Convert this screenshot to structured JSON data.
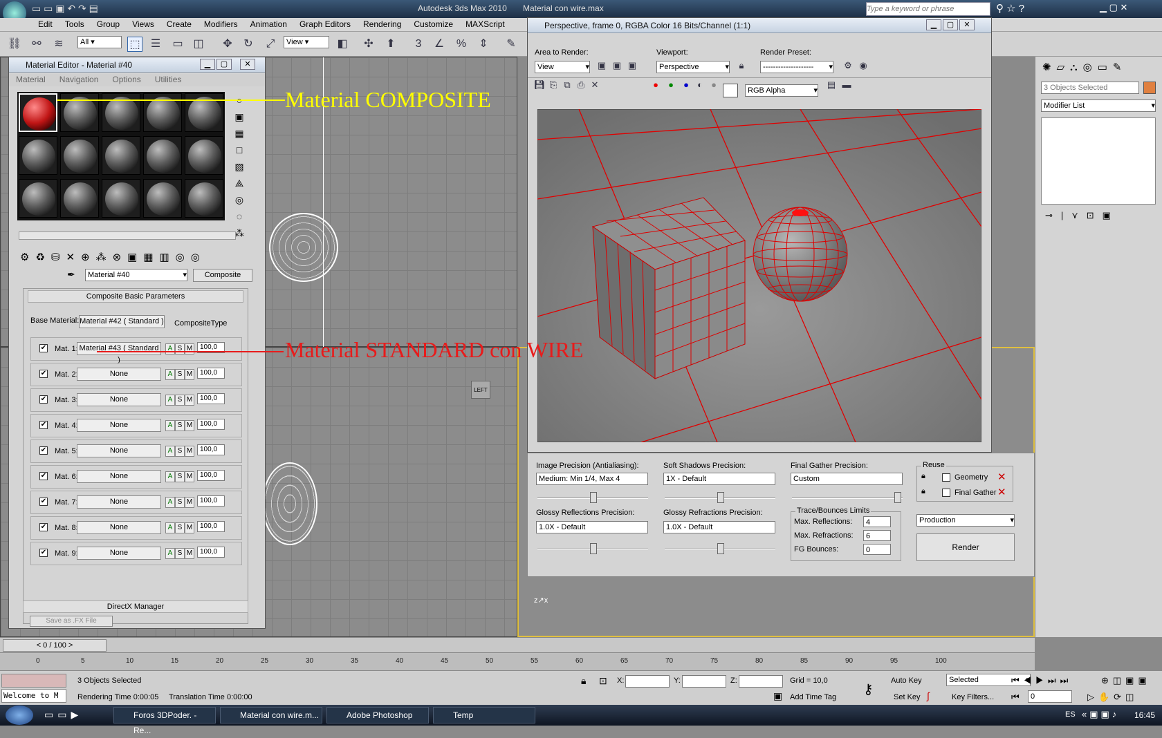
{
  "app": {
    "title": "Autodesk 3ds Max  2010",
    "file": "Material con wire.max",
    "search_placeholder": "Type a keyword or phrase"
  },
  "menu": [
    "Edit",
    "Tools",
    "Group",
    "Views",
    "Create",
    "Modifiers",
    "Animation",
    "Graph Editors",
    "Rendering",
    "Customize",
    "MAXScript"
  ],
  "toolbar": {
    "selection_filter": "All",
    "ref_coord": "View"
  },
  "material_editor": {
    "title": "Material Editor - Material #40",
    "menu": [
      "Material",
      "Navigation",
      "Options",
      "Utilities"
    ],
    "material_name": "Material #40",
    "material_type": "Composite",
    "rollout_title": "Composite Basic Parameters",
    "base_label": "Base Material:",
    "base_value": "Material #42  ( Standard )",
    "composite_type": "CompositeType",
    "rows": [
      {
        "label": "Mat. 1:",
        "value": "Material #43  ( Standard )",
        "amount": "100,0"
      },
      {
        "label": "Mat. 2:",
        "value": "None",
        "amount": "100,0"
      },
      {
        "label": "Mat. 3:",
        "value": "None",
        "amount": "100,0"
      },
      {
        "label": "Mat. 4:",
        "value": "None",
        "amount": "100,0"
      },
      {
        "label": "Mat. 5:",
        "value": "None",
        "amount": "100,0"
      },
      {
        "label": "Mat. 6:",
        "value": "None",
        "amount": "100,0"
      },
      {
        "label": "Mat. 7:",
        "value": "None",
        "amount": "100,0"
      },
      {
        "label": "Mat. 8:",
        "value": "None",
        "amount": "100,0"
      },
      {
        "label": "Mat. 9:",
        "value": "None",
        "amount": "100,0"
      }
    ],
    "asm": [
      "A",
      "S",
      "M"
    ],
    "directx": "DirectX Manager",
    "save_fx": "Save as .FX File"
  },
  "annotations": {
    "composite": "Material COMPOSITE",
    "standard": "Material STANDARD con WIRE"
  },
  "render_window": {
    "title": "Perspective, frame 0, RGBA Color 16 Bits/Channel (1:1)",
    "area_label": "Area to Render:",
    "area_value": "View",
    "viewport_label": "Viewport:",
    "viewport_value": "Perspective",
    "preset_label": "Render Preset:",
    "preset_value": "--------------------",
    "channel": "RGB Alpha"
  },
  "render_settings": {
    "image_precision_label": "Image Precision (Antialiasing):",
    "image_precision": "Medium: Min 1/4, Max 4",
    "soft_shadows_label": "Soft Shadows Precision:",
    "soft_shadows": "1X - Default",
    "final_gather_label": "Final Gather Precision:",
    "final_gather": "Custom",
    "glossy_refl_label": "Glossy Reflections Precision:",
    "glossy_refl": "1.0X - Default",
    "glossy_refr_label": "Glossy Refractions Precision:",
    "glossy_refr": "1.0X - Default",
    "trace_label": "Trace/Bounces Limits",
    "max_refl_label": "Max. Reflections:",
    "max_refl": "4",
    "max_refr_label": "Max. Refractions:",
    "max_refr": "6",
    "fg_bounces_label": "FG Bounces:",
    "fg_bounces": "0",
    "reuse_label": "Reuse",
    "geometry": "Geometry",
    "final_gather_cb": "Final Gather",
    "mode": "Production",
    "render_button": "Render"
  },
  "command_panel": {
    "selection": "3 Objects Selected",
    "modifier_list": "Modifier List"
  },
  "timeline": {
    "frame": "0 / 100",
    "ticks": [
      "0",
      "5",
      "10",
      "15",
      "20",
      "25",
      "30",
      "35",
      "40",
      "45",
      "50",
      "55",
      "60",
      "65",
      "70",
      "75",
      "80",
      "85",
      "90",
      "95",
      "100"
    ]
  },
  "status": {
    "selected": "3 Objects Selected",
    "render_time": "Rendering Time  0:00:05",
    "translation_time": "Translation Time  0:00:00",
    "maxscript": "Welcome to M",
    "x": "X:",
    "y": "Y:",
    "z": "Z:",
    "grid": "Grid = 10,0",
    "add_time_tag": "Add Time Tag",
    "auto_key": "Auto Key",
    "set_key": "Set Key",
    "key_mode": "Selected",
    "key_filters": "Key Filters...",
    "frame_value": "0"
  },
  "viewport_label": "LEFT",
  "taskbar": {
    "items": [
      "Foros 3DPoder. - Re...",
      "Material con wire.m...",
      "Adobe Photoshop",
      "Temp"
    ],
    "lang": "ES",
    "clock": "16:45"
  },
  "colors": {
    "annot_yellow": "#ffff00",
    "annot_red": "#e81b1b",
    "wire_red": "#e00000"
  }
}
